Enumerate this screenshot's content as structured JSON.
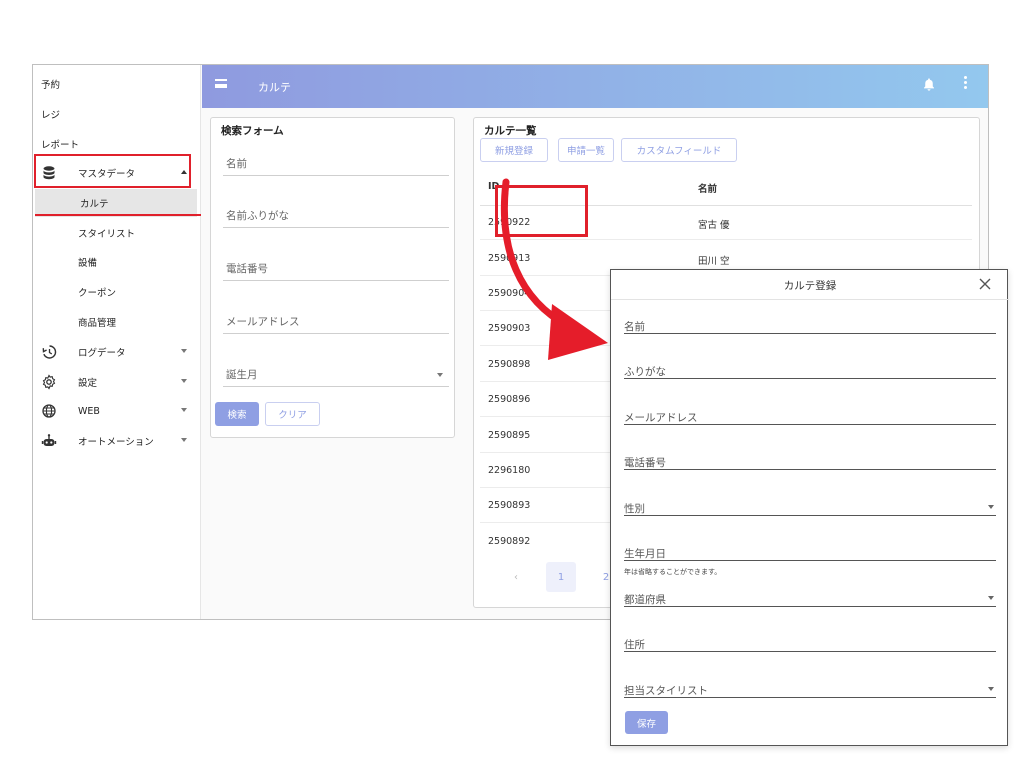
{
  "sidebar": {
    "items": [
      {
        "label": "予約"
      },
      {
        "label": "レジ"
      },
      {
        "label": "レポート"
      },
      {
        "label": "マスタデータ",
        "icon": "database-icon"
      },
      {
        "label": "カルテ"
      },
      {
        "label": "スタイリスト"
      },
      {
        "label": "設備"
      },
      {
        "label": "クーポン"
      },
      {
        "label": "商品管理"
      },
      {
        "label": "ログデータ",
        "icon": "history-icon"
      },
      {
        "label": "設定",
        "icon": "gear-icon"
      },
      {
        "label": "WEB",
        "icon": "globe-icon"
      },
      {
        "label": "オートメーション",
        "icon": "robot-icon"
      }
    ]
  },
  "header": {
    "title": "カルテ"
  },
  "search": {
    "title": "検索フォーム",
    "fields": [
      "名前",
      "名前ふりがな",
      "電話番号",
      "メールアドレス",
      "誕生月"
    ],
    "search_label": "検索",
    "clear_label": "クリア"
  },
  "list": {
    "title": "カルテ一覧",
    "buttons": [
      "新規登録",
      "申請一覧",
      "カスタムフィールド"
    ],
    "columns": [
      "ID",
      "名前"
    ],
    "rows": [
      {
        "id": "2590922",
        "name": "宮古 優"
      },
      {
        "id": "2590913",
        "name": "田川 空"
      },
      {
        "id": "2590904",
        "name": ""
      },
      {
        "id": "2590903",
        "name": ""
      },
      {
        "id": "2590898",
        "name": ""
      },
      {
        "id": "2590896",
        "name": ""
      },
      {
        "id": "2590895",
        "name": ""
      },
      {
        "id": "2296180",
        "name": ""
      },
      {
        "id": "2590893",
        "name": ""
      },
      {
        "id": "2590892",
        "name": ""
      }
    ],
    "pagination": {
      "prev": "‹",
      "current": "1",
      "next": "2"
    }
  },
  "dialog": {
    "title": "カルテ登録",
    "fields": [
      "名前",
      "ふりがな",
      "メールアドレス",
      "電話番号",
      "性別",
      "生年月日",
      "都道府県",
      "住所",
      "担当スタイリスト"
    ],
    "birth_hint": "年は省略することができます。",
    "save_label": "保存"
  },
  "colors": {
    "accent": "#8f9fe3",
    "highlight": "#e0202b"
  }
}
